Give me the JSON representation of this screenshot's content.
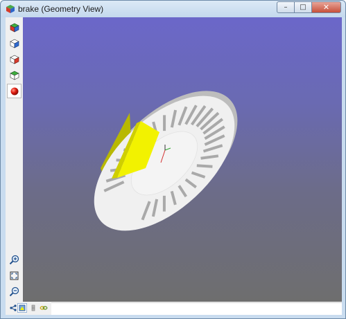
{
  "window": {
    "title": "brake (Geometry View)",
    "controls": {
      "minimize": "–",
      "maximize": "□",
      "close": "✕"
    }
  },
  "left_toolbar": {
    "top_tools": [
      {
        "icon": "iso-view-cube-icon"
      },
      {
        "icon": "front-view-cube-icon"
      },
      {
        "icon": "side-view-cube-icon"
      },
      {
        "icon": "top-view-cube-icon"
      },
      {
        "icon": "shading-sphere-icon",
        "active": true
      }
    ],
    "bottom_tools": [
      {
        "icon": "zoom-in-icon"
      },
      {
        "icon": "zoom-fit-icon"
      },
      {
        "icon": "zoom-out-icon"
      }
    ]
  },
  "viewport": {
    "background_top": "#6b67c9",
    "background_bottom": "#6e6e6e",
    "model_colors": {
      "disc": "#f0f0f0",
      "pad": "#f2f200",
      "slots": "#a9a9a9"
    }
  },
  "bottom_bar": {
    "tools": [
      {
        "icon": "share-icon"
      },
      {
        "icon": "view-mode-icon",
        "selected": true
      },
      {
        "icon": "list-icon"
      },
      {
        "icon": "link-icon"
      }
    ],
    "status_text": ""
  }
}
